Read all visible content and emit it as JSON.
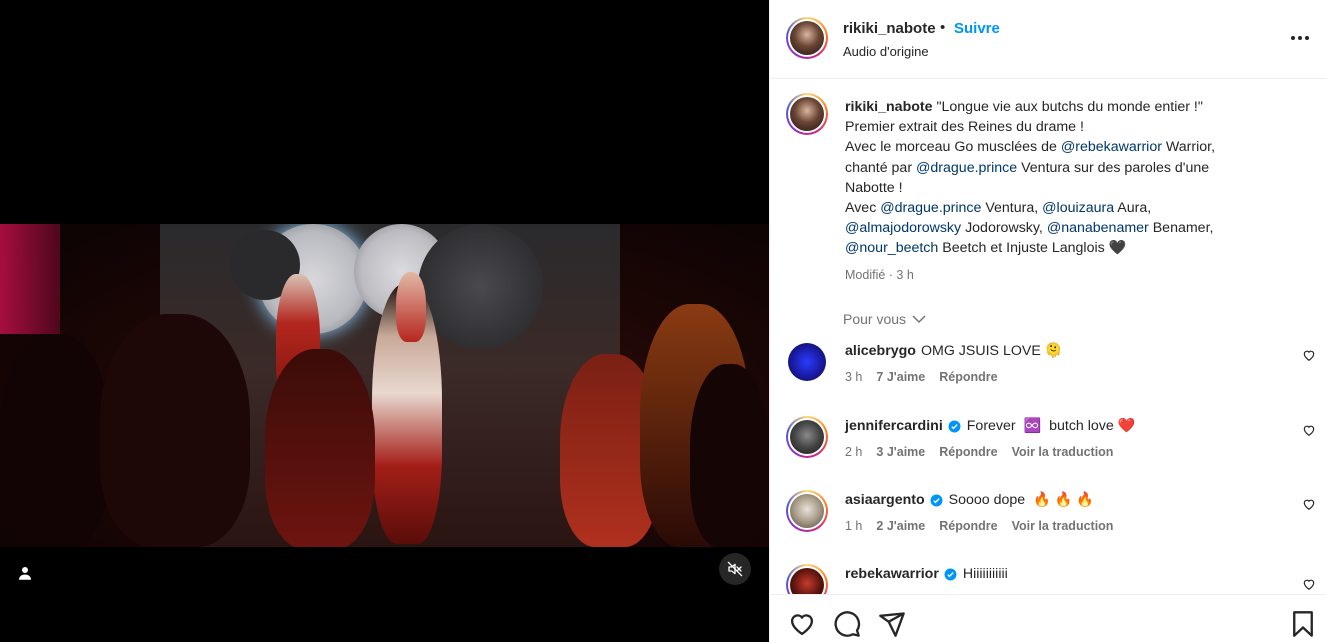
{
  "post": {
    "username": "rikiki_nabote",
    "dot": "•",
    "follow_label": "Suivre",
    "audio": "Audio d'origine"
  },
  "caption": {
    "username": "rikiki_nabote",
    "line1": " \"Longue vie aux butchs du monde entier !\"",
    "line2": "Premier extrait des Reines du drame !",
    "line3a": "Avec le morceau Go musclées de ",
    "mention1": "@rebekawarrior",
    "line3b": " Warrior,",
    "line4a": "chanté par ",
    "mention2": "@drague.prince",
    "line4b": " Ventura sur des paroles d'une",
    "line5": "Nabotte !",
    "line6a": "Avec ",
    "mention3": "@drague.prince",
    "line6b": " Ventura, ",
    "mention4": "@louizaura",
    "line6c": " Aura,",
    "mention5": "@almajodorowsky",
    "line7a": " Jodorowsky, ",
    "mention6": "@nanabenamer",
    "line7b": " Benamer,",
    "mention7": "@nour_beetch",
    "line8": " Beetch et Injuste Langlois ",
    "heart_emoji": "🖤",
    "meta": "Modifié · 3 h"
  },
  "for_you": "Pour vous",
  "comments": [
    {
      "username": "alicebrygo",
      "verified": false,
      "text": "OMG JSUIS LOVE",
      "emoji": "🫠",
      "time": "3 h",
      "likes": "7 J'aime",
      "reply": "Répondre",
      "translate": ""
    },
    {
      "username": "jennifercardini",
      "verified": true,
      "text": "Forever",
      "emoji": "♾️",
      "text2": "butch love",
      "emoji2": "❤️",
      "time": "2 h",
      "likes": "3 J'aime",
      "reply": "Répondre",
      "translate": "Voir la traduction"
    },
    {
      "username": "asiaargento",
      "verified": true,
      "text": "Soooo dope",
      "emoji": "🔥 🔥 🔥",
      "time": "1 h",
      "likes": "2 J'aime",
      "reply": "Répondre",
      "translate": "Voir la traduction"
    },
    {
      "username": "rebekawarrior",
      "verified": true,
      "text": "Hiiiiiiiiiii",
      "emoji": "",
      "time": "",
      "likes": "",
      "reply": "",
      "translate": ""
    }
  ],
  "icons": {
    "like": "heart-icon",
    "comment": "comment-icon",
    "share": "send-icon",
    "save": "bookmark-icon",
    "mute": "muted-speaker-icon",
    "tags": "user-tag-icon",
    "more": "more-options-icon"
  },
  "colors": {
    "follow": "#0095f6",
    "mention": "#00376b",
    "verified": "#0095f6",
    "muted_text": "#737373"
  }
}
